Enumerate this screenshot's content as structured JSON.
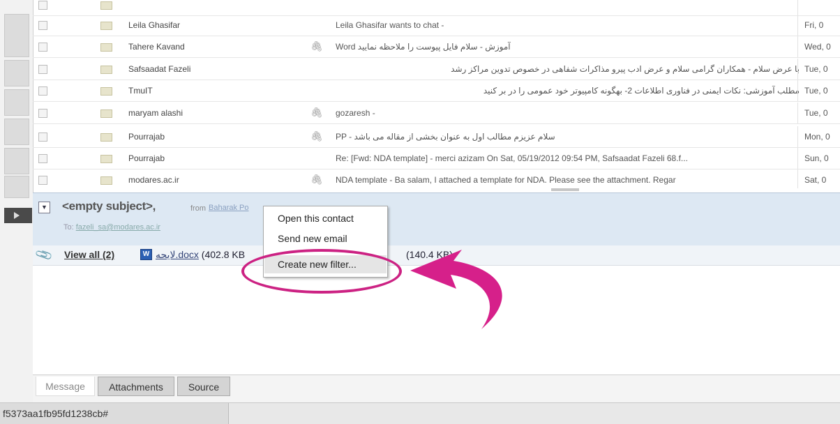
{
  "messages": [
    {
      "from": "Leila Ghasifar",
      "subject": "Leila Ghasifar wants to chat -",
      "date": "Fri, 0",
      "attachment": false
    },
    {
      "from": "Tahere Kavand",
      "subject": "Word آموزش - سلام فایل پیوست را ملاحظه نمایید",
      "date": "Wed, 0",
      "attachment": true
    },
    {
      "from": "Safsaadat Fazeli",
      "subject": "با عرض سلام - همکاران گرامی سلام و عرض ادب پیرو مذاکرات شفاهی در خصوص تدوین مراکز رشد",
      "date": "Tue, 0",
      "attachment": false
    },
    {
      "from": "TmuIT",
      "subject": "مطلب آموزشی: نکات ایمنی در فناوری اطلاعات 2- بهگونه کامپیوتر خود عمومی را در بر کنید",
      "date": "Tue, 0",
      "attachment": false
    },
    {
      "from": "maryam alashi",
      "subject": "gozaresh -",
      "date": "Tue, 0",
      "attachment": true
    },
    {
      "from": "Pourrajab",
      "subject": "PP - سلام عزیزم مطالب اول به عنوان بخشی از مقاله می باشد",
      "date": "Mon, 0",
      "attachment": true
    },
    {
      "from": "Pourrajab",
      "subject": "Re: [Fwd: NDA template] - merci azizam On Sat, 05/19/2012 09:54 PM, Safsaadat Fazeli 68.f...",
      "date": "Sun, 0",
      "attachment": false
    },
    {
      "from": "modares.ac.ir",
      "subject": "NDA template - Ba salam, I attached a template for NDA. Please see the attachment. Regar",
      "date": "Sat, 0",
      "attachment": true
    }
  ],
  "preview": {
    "subject": "<empty subject>,",
    "from_label": "from",
    "from_name": "Baharak Po",
    "to_label": "To:",
    "to_address": "fazeli_sa@modares.ac.ir"
  },
  "attachments": {
    "view_all": "View all (2)",
    "file1_name": "لایحه.docx",
    "file1_size": " (402.8 KB",
    "file2_size": "(140.4 KB)"
  },
  "context_menu": {
    "items": [
      "Open this contact",
      "Send new email",
      "Create new filter..."
    ]
  },
  "tabs": [
    "Message",
    "Attachments",
    "Source"
  ],
  "status": {
    "url": "f5373aa1fb95fd1238cb#"
  },
  "colors": {
    "highlight": "#cc2283",
    "preview_bg": "#dde8f3"
  }
}
